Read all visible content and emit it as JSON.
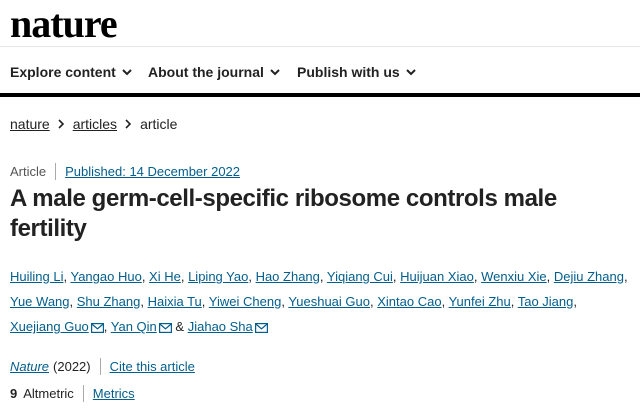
{
  "site": {
    "logo": "nature"
  },
  "nav": {
    "items": [
      {
        "label": "Explore content"
      },
      {
        "label": "About the journal"
      },
      {
        "label": "Publish with us"
      }
    ]
  },
  "breadcrumb": [
    "nature",
    "articles",
    "article"
  ],
  "article": {
    "type": "Article",
    "published": "Published: 14 December 2022",
    "title": "A male germ-cell-specific ribosome controls male fertility",
    "authors": [
      "Huiling Li",
      "Yangao Huo",
      "Xi He",
      "Liping Yao",
      "Hao Zhang",
      "Yiqiang Cui",
      "Huijuan Xiao",
      "Wenxiu Xie",
      "Dejiu Zhang",
      "Yue Wang",
      "Shu Zhang",
      "Haixia Tu",
      "Yiwei Cheng",
      "Yueshuai Guo",
      "Xintao Cao",
      "Yunfei Zhu",
      "Tao Jiang",
      "Xuejiang Guo",
      "Yan Qin",
      "Jiahao Sha"
    ],
    "ampersand": "&",
    "journal": "Nature",
    "year": "(2022)",
    "cite": "Cite this article",
    "altmetric_score": "9",
    "altmetric_label": "Altmetric",
    "metrics": "Metrics"
  },
  "colors": {
    "link": "#025e8d",
    "text": "#222222",
    "rule": "#000000"
  },
  "icons": {
    "nav_chevron": "chevron-down-icon",
    "breadcrumb_sep": "chevron-right-icon",
    "author_email": "mail-icon"
  }
}
